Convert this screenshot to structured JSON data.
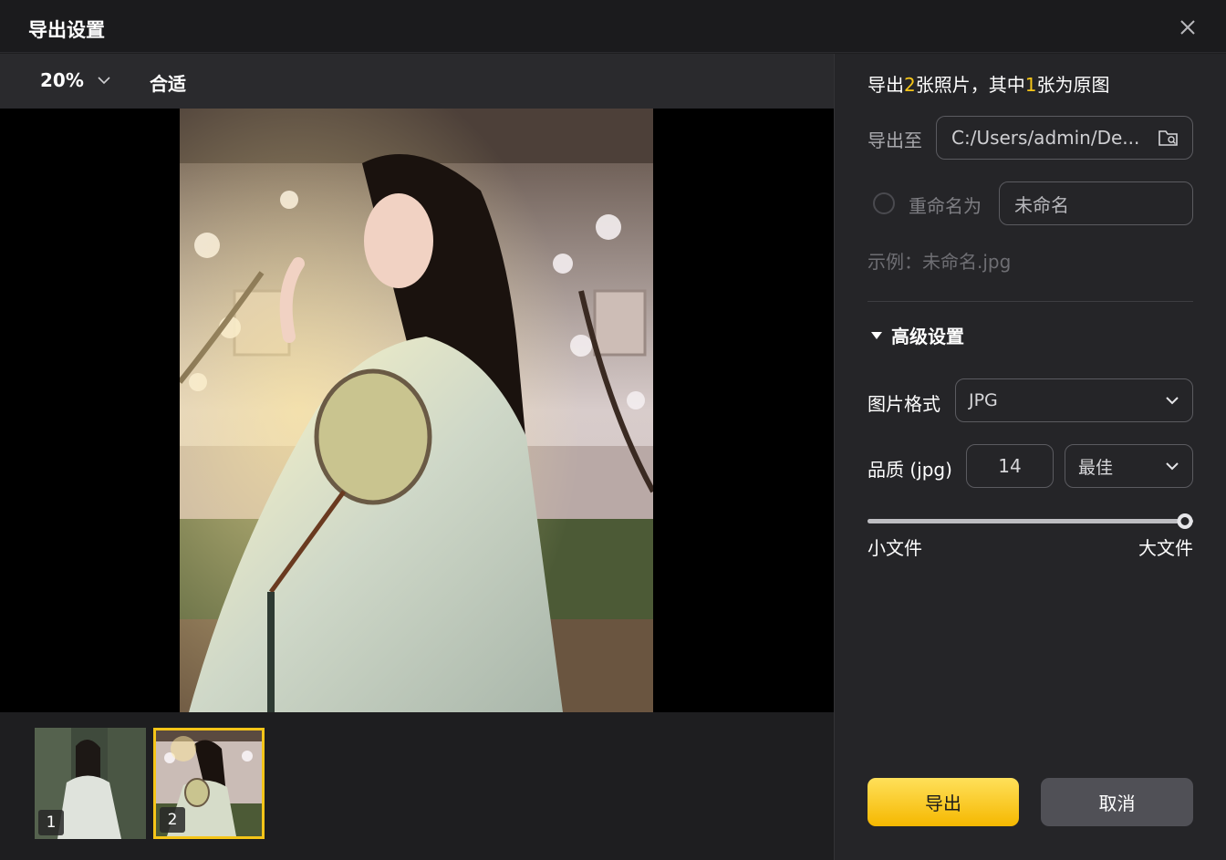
{
  "window": {
    "title": "导出设置"
  },
  "toolbar": {
    "zoom": "20%",
    "fit_label": "合适"
  },
  "thumbnails": [
    {
      "number": "1",
      "selected": false
    },
    {
      "number": "2",
      "selected": true
    }
  ],
  "summary": {
    "prefix": "导出",
    "total": "2",
    "middle": "张照片，其中",
    "original": "1",
    "suffix": "张为原图"
  },
  "export_to": {
    "label": "导出至",
    "path": "C:/Users/admin/De..."
  },
  "rename": {
    "label": "重命名为",
    "value": "未命名",
    "checked": false
  },
  "example": "示例：未命名.jpg",
  "advanced": {
    "title": "高级设置"
  },
  "format": {
    "label": "图片格式",
    "value": "JPG"
  },
  "quality": {
    "label": "品质 (jpg)",
    "value": "14",
    "level": "最佳",
    "slider_fraction": 1.0
  },
  "slider_labels": {
    "min": "小文件",
    "max": "大文件"
  },
  "buttons": {
    "export": "导出",
    "cancel": "取消"
  },
  "colors": {
    "accent": "#f5c518",
    "panel": "#252528"
  }
}
